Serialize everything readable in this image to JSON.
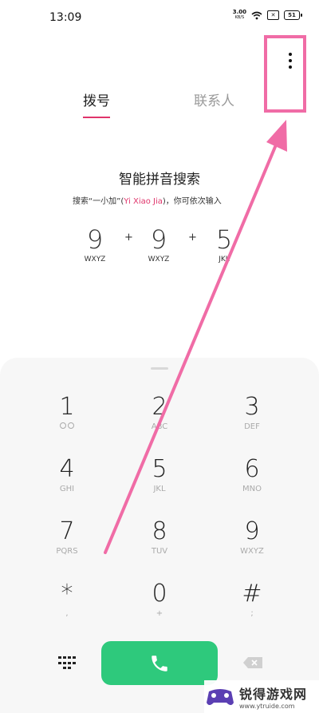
{
  "status_bar": {
    "time": "13:09",
    "speed_value": "3.00",
    "speed_unit": "KB/S",
    "sim_label": "✕",
    "battery": "51"
  },
  "tabs": {
    "dial": "拨号",
    "contacts": "联系人"
  },
  "hint": {
    "title": "智能拼音搜索",
    "desc_prefix": "搜索“一小加”(",
    "desc_pinyin": "Yi Xiao Jia",
    "desc_suffix": ")，你可依次输入"
  },
  "example": {
    "keys": [
      {
        "digit": "9",
        "letters": "WXYZ"
      },
      {
        "digit": "9",
        "letters": "WXYZ"
      },
      {
        "digit": "5",
        "letters": "JKL"
      }
    ],
    "plus": "+"
  },
  "keypad": {
    "keys": [
      {
        "digit": "1",
        "sub": ""
      },
      {
        "digit": "2",
        "sub": "ABC"
      },
      {
        "digit": "3",
        "sub": "DEF"
      },
      {
        "digit": "4",
        "sub": "GHI"
      },
      {
        "digit": "5",
        "sub": "JKL"
      },
      {
        "digit": "6",
        "sub": "MNO"
      },
      {
        "digit": "7",
        "sub": "PQRS"
      },
      {
        "digit": "8",
        "sub": "TUV"
      },
      {
        "digit": "9",
        "sub": "WXYZ"
      },
      {
        "digit": "*",
        "sub": ","
      },
      {
        "digit": "0",
        "sub": "+"
      },
      {
        "digit": "#",
        "sub": ";"
      }
    ]
  },
  "icons": {
    "more": "more-vertical-icon",
    "voicemail": "voicemail-icon",
    "phone": "phone-icon",
    "dialpad": "dialpad-grid-icon",
    "backspace": "backspace-icon",
    "wifi": "wifi-icon"
  },
  "colors": {
    "accent": "#e0346b",
    "call": "#2ec97c",
    "annotation": "#f06ca6"
  },
  "watermark": {
    "title": "锐得游戏网",
    "url": "www.ytruide.com"
  }
}
